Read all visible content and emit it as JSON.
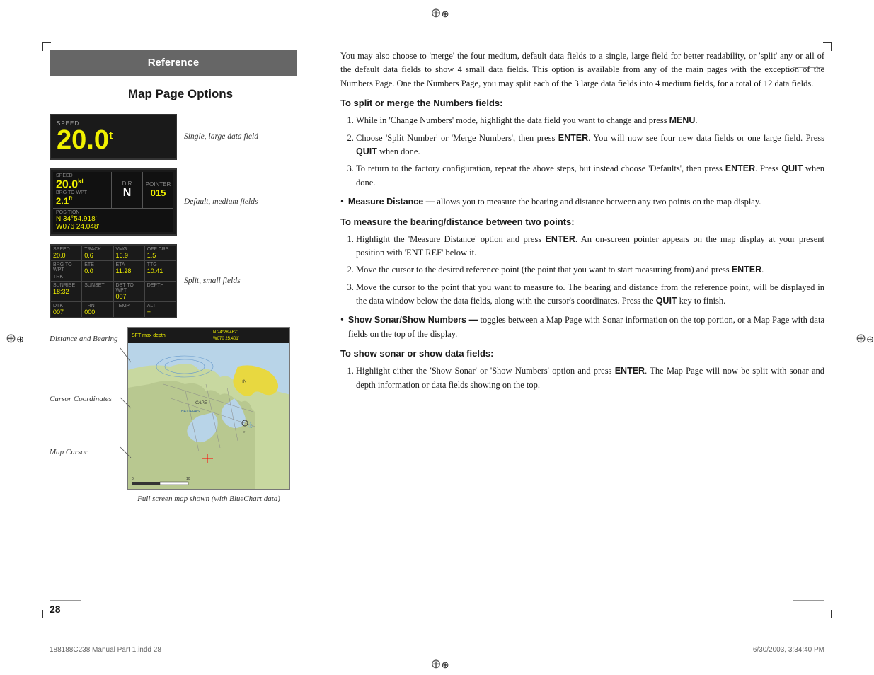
{
  "page": {
    "number": "28",
    "footer_left": "188188C238 Manual Part 1.indd  28",
    "footer_right": "6/30/2003, 3:34:40 PM"
  },
  "header": {
    "reference_label": "Reference"
  },
  "left": {
    "title": "Map Page Options",
    "field_labels": {
      "large": "Single, large data field",
      "medium": "Default, medium fields",
      "small": "Split, small fields",
      "distance_bearing": "Distance and\nBearing",
      "cursor_coords": "Cursor\nCoordinates",
      "map_cursor": "Map Cursor",
      "caption": "Full screen map shown\n(with BlueChart data)"
    },
    "large_field": {
      "label": "SPEED",
      "value": "20.0",
      "unit": "kt"
    },
    "medium_fields": {
      "speed": "20.0",
      "speed_unit": "kt",
      "direction": "N",
      "bearing": "015",
      "lat1": "N 34°54.918'",
      "lat2": "W076 24.048'",
      "depth": "2.1",
      "depth_unit": "ft"
    },
    "small_fields_row1": [
      "20.0",
      "0.6",
      "16.9",
      "1.5"
    ],
    "small_fields_row2": [
      "0.0",
      "11:28",
      "10:41"
    ],
    "small_fields_row3": [
      "18:32",
      "",
      "007"
    ],
    "small_fields_row4": [
      "007",
      "000",
      ""
    ]
  },
  "right": {
    "intro": "You may also choose to 'merge' the four medium, default data fields to a single, large field for better readability, or 'split' any or all of the default data fields to show 4 small data fields. This option is available from any of the main pages with the exception of the Numbers Page. One the Numbers Page, you may split each of the 3 large data fields into 4 medium fields, for a total of 12 data fields.",
    "section1": {
      "heading": "To split or merge the Numbers fields:",
      "steps": [
        "While in 'Change Numbers' mode, highlight the data field you want to change and press MENU.",
        "Choose 'Split Number' or 'Merge Numbers', then press ENTER. You will now see four new data fields or one large field. Press QUIT when done.",
        "To return to the factory configuration, repeat the above steps, but instead choose 'Defaults', then press ENTER. Press QUIT when done."
      ]
    },
    "bullet1": {
      "term": "Measure Distance —",
      "desc": "allows you to measure the bearing and distance between any two points on the map display."
    },
    "section2": {
      "heading": "To measure the bearing/distance between two points:",
      "steps": [
        "Highlight the 'Measure Distance' option and press ENTER. An on-screen pointer appears on the map display at your present position with 'ENT REF' below it.",
        "Move the cursor to the desired reference point (the point that you want to start measuring from) and press ENTER.",
        "Move the cursor to the point that you want to measure to. The bearing and distance from the reference point, will be displayed in the data window below the data fields, along with the cursor's coordinates. Press the QUIT key to finish."
      ]
    },
    "bullet2": {
      "term": "Show Sonar/Show Numbers —",
      "desc": "toggles between a Map Page with Sonar information on the top portion, or a Map Page with data fields on the top of the display."
    },
    "section3": {
      "heading": "To show sonar or show data fields:",
      "steps": [
        "Highlight either the 'Show Sonar' or 'Show Numbers' option and press ENTER. The Map Page will now be split with sonar and depth information or data fields showing on the top."
      ]
    }
  }
}
